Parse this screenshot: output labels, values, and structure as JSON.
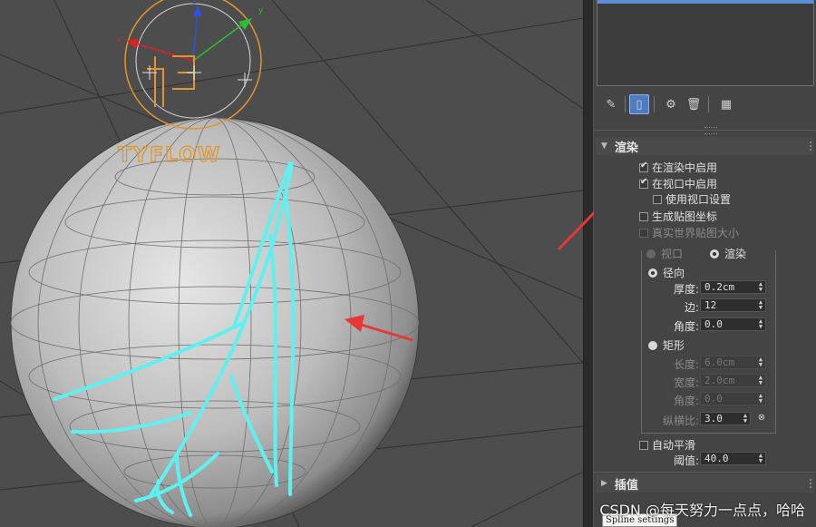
{
  "viewport": {
    "logo_text": "TYFLOW",
    "gizmo_axes": [
      "x",
      "y",
      "z"
    ],
    "colors": {
      "background": "#4d4d4d",
      "sphere": "#c8c8c8",
      "spline": "#5ff0f0",
      "gizmo": "#e0962a",
      "arrow": "#e53935"
    }
  },
  "toolbar": {
    "icons": [
      "pin-icon",
      "modifier-stack-icon",
      "make-unique-icon",
      "trash-icon",
      "configure-icon"
    ]
  },
  "rendering": {
    "title": "渲染",
    "enable_in_renderer": {
      "label": "在渲染中启用",
      "checked": true
    },
    "enable_in_viewport": {
      "label": "在视口中启用",
      "checked": true
    },
    "use_viewport_settings": {
      "label": "使用视口设置",
      "checked": false
    },
    "generate_mapping": {
      "label": "生成贴图坐标",
      "checked": false
    },
    "real_world_map_size": {
      "label": "真实世界贴图大小",
      "checked": false
    },
    "mode_viewport": {
      "label": "视口",
      "selected": false
    },
    "mode_render": {
      "label": "渲染",
      "selected": true
    },
    "radial": {
      "label": "径向",
      "selected": true,
      "thickness": {
        "label": "厚度:",
        "value": "0.2cm"
      },
      "sides": {
        "label": "边:",
        "value": "12"
      },
      "angle": {
        "label": "角度:",
        "value": "0.0"
      }
    },
    "rectangular": {
      "label": "矩形",
      "selected": false,
      "length": {
        "label": "长度:",
        "value": "6.0cm"
      },
      "width": {
        "label": "宽度:",
        "value": "2.0cm"
      },
      "angle": {
        "label": "角度:",
        "value": "0.0"
      },
      "aspect": {
        "label": "纵横比:",
        "value": "3.0"
      }
    },
    "auto_smooth": {
      "label": "自动平滑",
      "checked": false
    },
    "threshold": {
      "label": "阈值:",
      "value": "40.0"
    }
  },
  "interpolation": {
    "title": "插值"
  },
  "tooltip": "Spline settings",
  "watermark": "CSDN @每天努力一点点，哈哈"
}
